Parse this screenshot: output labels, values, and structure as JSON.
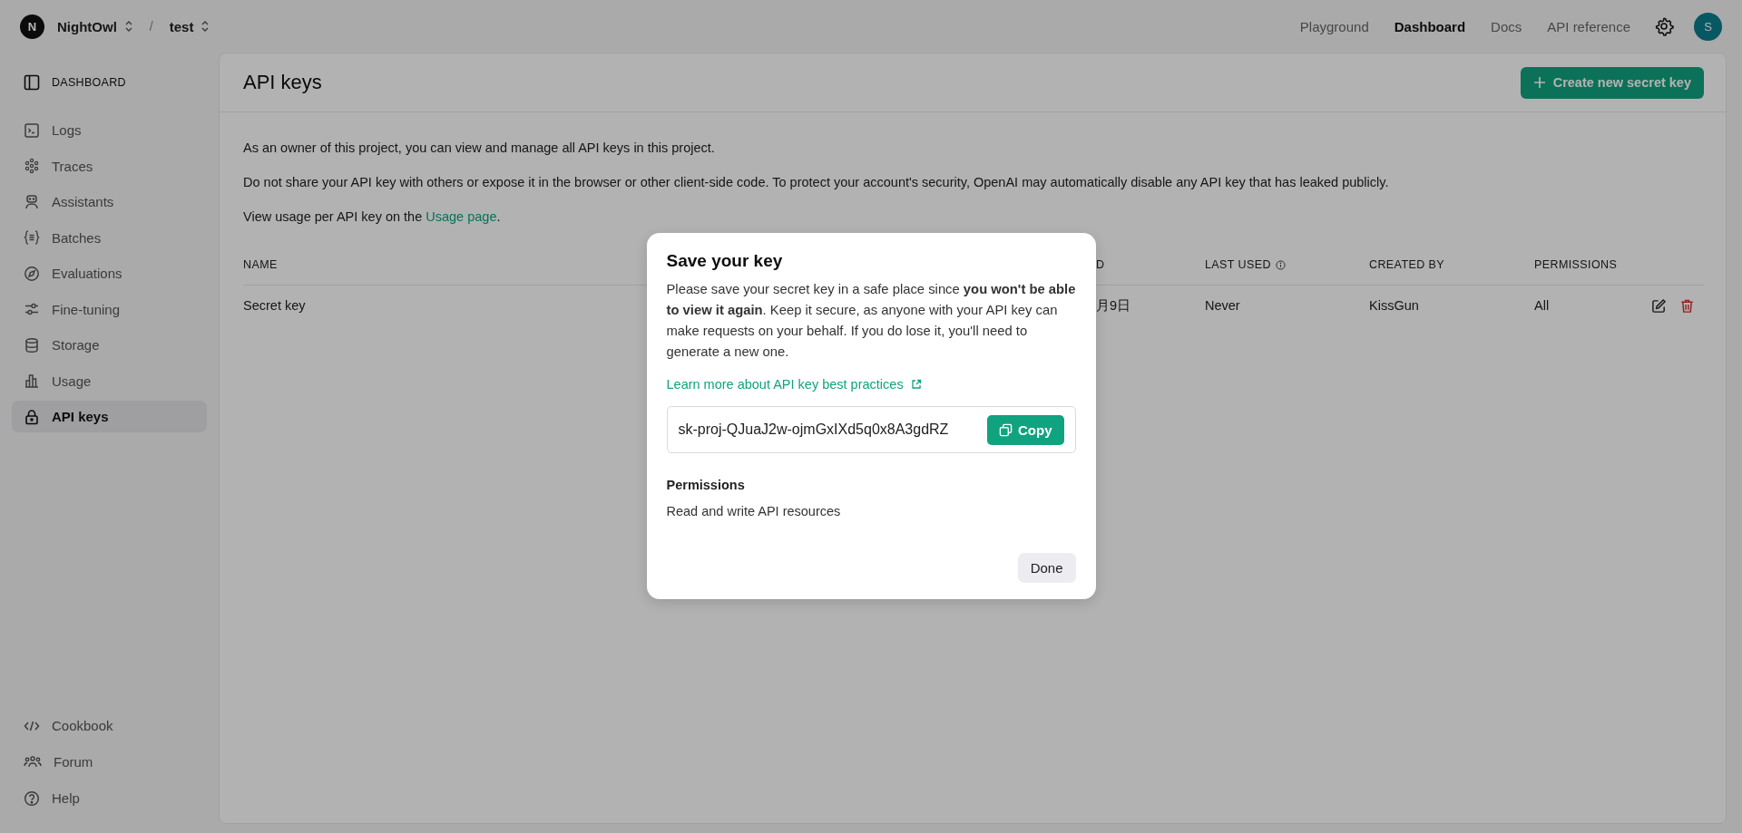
{
  "topbar": {
    "organization": {
      "initial": "N",
      "name": "NightOwl"
    },
    "separator": "/",
    "project": "test",
    "nav": [
      {
        "label": "Playground",
        "selected": false
      },
      {
        "label": "Dashboard",
        "selected": true
      },
      {
        "label": "Docs",
        "selected": false
      },
      {
        "label": "API reference",
        "selected": false
      }
    ],
    "avatar": "S"
  },
  "sidebar": {
    "heading": "DASHBOARD",
    "items": [
      {
        "label": "Logs",
        "selected": false
      },
      {
        "label": "Traces",
        "selected": false
      },
      {
        "label": "Assistants",
        "selected": false
      },
      {
        "label": "Batches",
        "selected": false
      },
      {
        "label": "Evaluations",
        "selected": false
      },
      {
        "label": "Fine-tuning",
        "selected": false
      },
      {
        "label": "Storage",
        "selected": false
      },
      {
        "label": "Usage",
        "selected": false
      },
      {
        "label": "API keys",
        "selected": true
      }
    ],
    "footer_items": [
      {
        "label": "Cookbook"
      },
      {
        "label": "Forum"
      },
      {
        "label": "Help"
      }
    ]
  },
  "page": {
    "title": "API keys",
    "create_button": "Create new secret key",
    "paragraphs": [
      "As an owner of this project, you can view and manage all API keys in this project.",
      "Do not share your API key with others or expose it in the browser or other client-side code. To protect your account's security, OpenAI may automatically disable any API key that has leaked publicly."
    ],
    "usage_note": {
      "before": "View usage per API key on the",
      "link": "Usage page",
      "after": "."
    },
    "table": {
      "columns": [
        "NAME",
        "D",
        "LAST USED",
        "CREATED BY",
        "PERMISSIONS"
      ],
      "rows": [
        {
          "cells": [
            "Secret key",
            "月9日",
            "Never",
            "KissGun",
            "All"
          ]
        }
      ]
    }
  },
  "modal": {
    "title": "Save your key",
    "description": "Please save your secret key in a safe place since **you won't be able to view it again**. Keep it secure, as anyone with your API key can make requests on your behalf. If you do lose it, you'll need to generate a new one.",
    "link": "Learn more about API key best practices",
    "key_value": "sk-proj-QJuaJ2w-ojmGxIXd5q0x8A3gdRZ",
    "copy_button": "Copy",
    "permissions_label": "Permissions",
    "permissions_value": "Read and write API resources",
    "done_button": "Done"
  }
}
